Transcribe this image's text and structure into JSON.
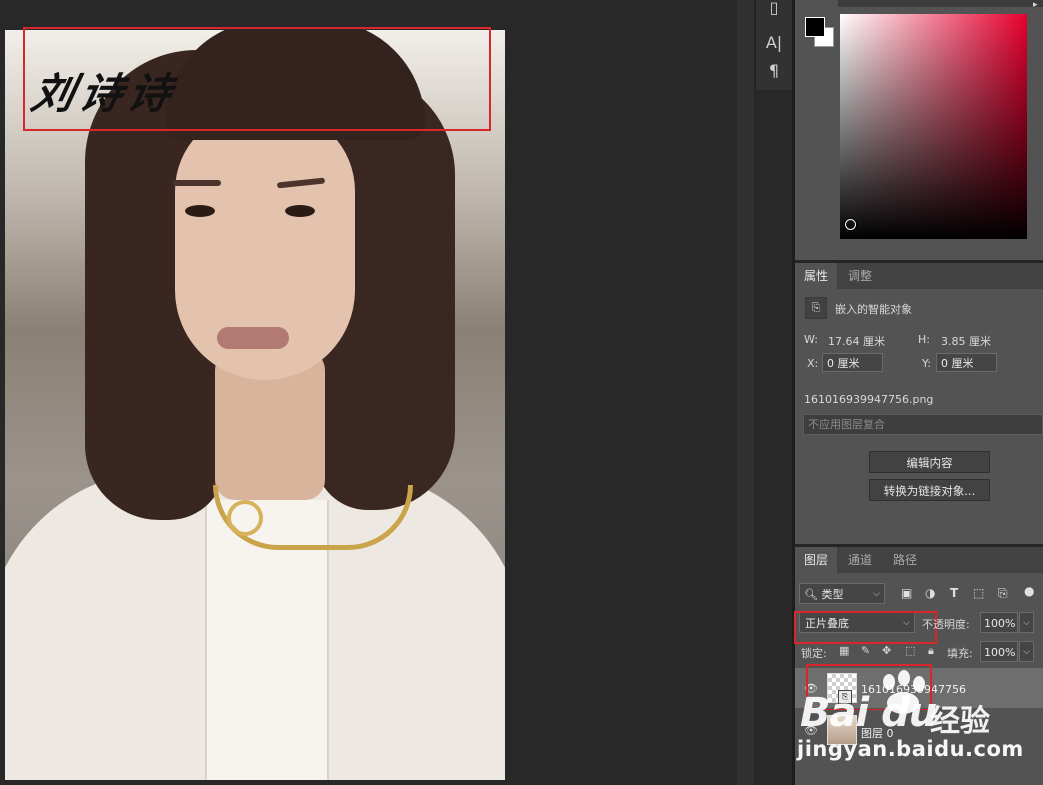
{
  "document": {
    "signature_text": "刘诗诗"
  },
  "tools": [
    {
      "icon": "phone-tool-icon",
      "glyph": "▯"
    },
    {
      "icon": "character-panel-icon",
      "glyph": "A|"
    },
    {
      "icon": "paragraph-panel-icon",
      "glyph": "¶"
    }
  ],
  "properties_panel": {
    "tabs": [
      "属性",
      "调整"
    ],
    "active_tab": "属性",
    "object_type": "嵌入的智能对象",
    "w_label": "W:",
    "w_value": "17.64 厘米",
    "h_label": "H:",
    "h_value": "3.85 厘米",
    "x_label": "X:",
    "x_value": "0 厘米",
    "y_label": "Y:",
    "y_value": "0 厘米",
    "filename": "161016939947756.png",
    "layer_comp_placeholder": "不应用图层复合",
    "edit_contents_button": "编辑内容",
    "convert_to_linked_button": "转换为链接对象..."
  },
  "layers_panel": {
    "tabs": [
      "图层",
      "通道",
      "路径"
    ],
    "active_tab": "图层",
    "filter_kind": "类型",
    "blend_mode": "正片叠底",
    "opacity_label": "不透明度:",
    "opacity_value": "100%",
    "lock_label": "锁定:",
    "fill_label": "填充:",
    "fill_value": "100%",
    "layers": [
      {
        "name": "161016939947756",
        "visible": true,
        "selected": true
      },
      {
        "name": "图层 0",
        "visible": true,
        "selected": false
      }
    ]
  },
  "watermark": {
    "logo_text": "Bai du",
    "logo_cn": "经验",
    "url": "jingyan.baidu.com"
  },
  "colors": {
    "annotation_red": "#d9262b",
    "foreground": "#000000",
    "background": "#ffffff",
    "hue": "#e8002e"
  }
}
